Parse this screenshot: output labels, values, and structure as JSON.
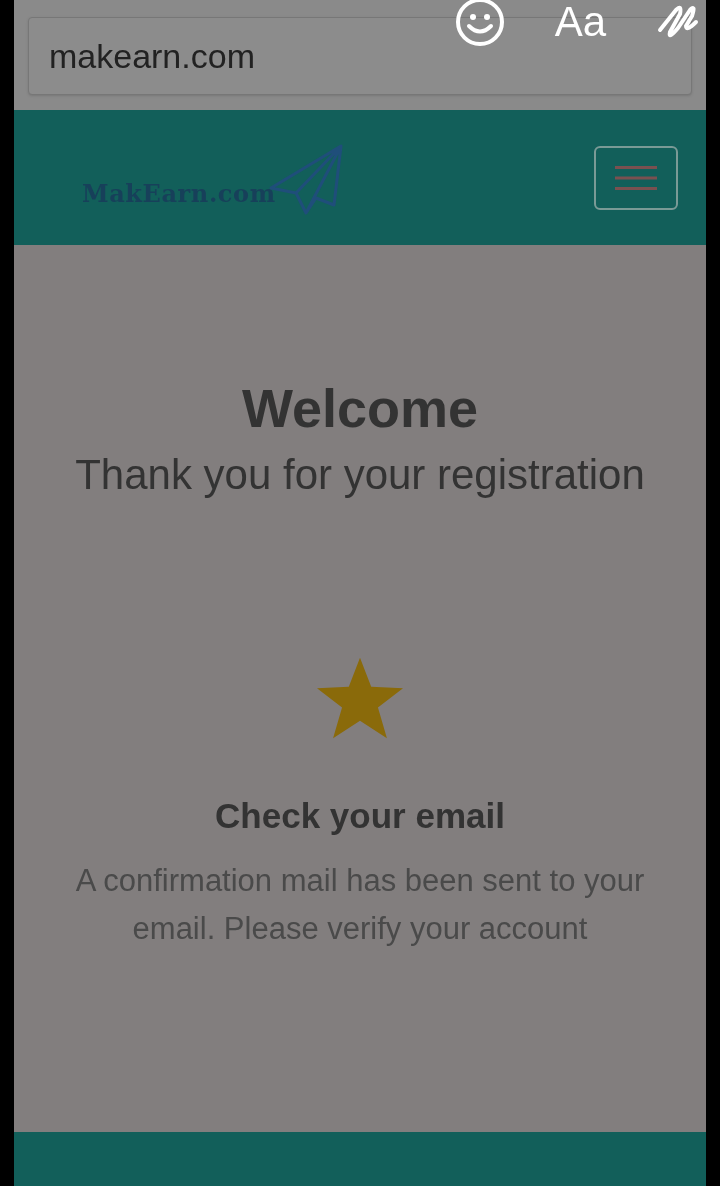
{
  "address_bar": {
    "url": "makearn.com"
  },
  "overlay_tools": [
    {
      "kind": "emoji"
    },
    {
      "kind": "text",
      "label": "Aa"
    },
    {
      "kind": "draw"
    }
  ],
  "header": {
    "logo_text": "MakEarn.com"
  },
  "content": {
    "title": "Welcome",
    "subtitle": "Thank you for your registration",
    "heading": "Check your email",
    "message": "A confirmation mail has been sent to your email. Please verify your account"
  }
}
